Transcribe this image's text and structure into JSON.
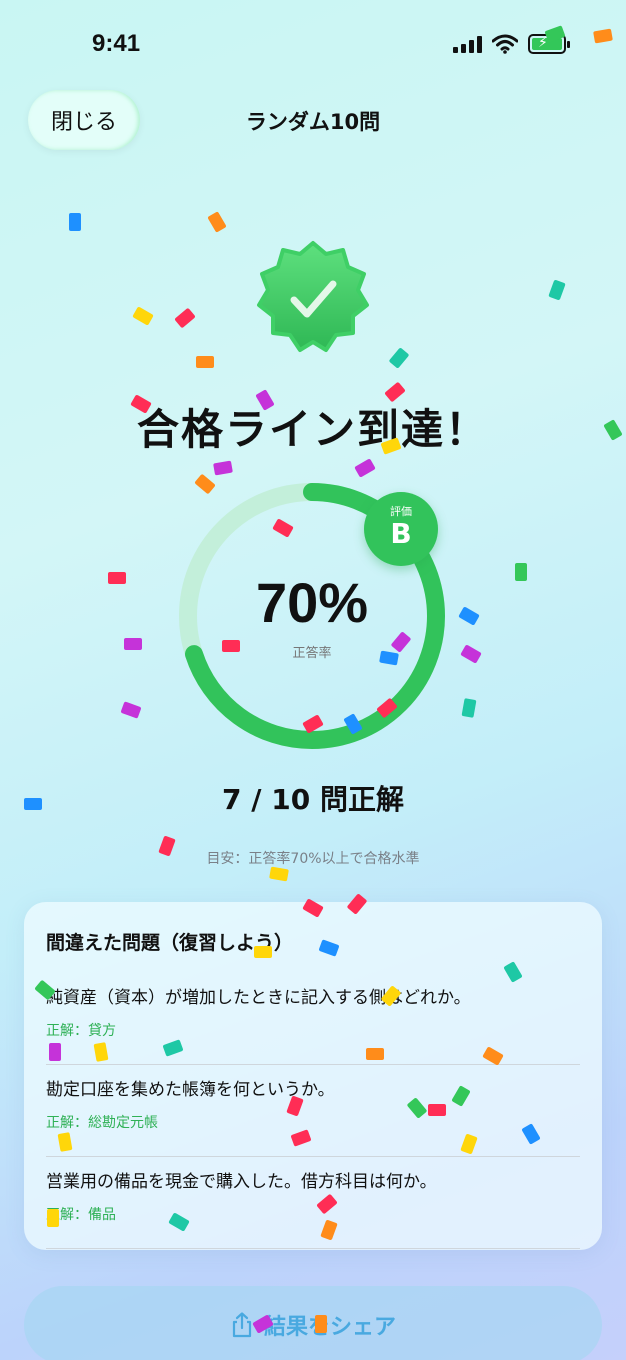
{
  "status_bar": {
    "time": "9:41"
  },
  "nav": {
    "close_label": "閉じる",
    "title": "ランダム10問"
  },
  "result": {
    "headline": "合格ライン到達！",
    "percent_text": "70%",
    "percent_value": 0.7,
    "percent_label": "正答率",
    "grade_label": "評価",
    "grade_value": "B",
    "score_text": "7 / 10 問正解",
    "hint": "目安：正答率70%以上で合格水準"
  },
  "mistakes": {
    "title": "間違えた問題（復習しよう）",
    "items": [
      {
        "question": "純資産（資本）が増加したときに記入する側はどれか。",
        "answer": "正解：貸方"
      },
      {
        "question": "勘定口座を集めた帳簿を何というか。",
        "answer": "正解：総勘定元帳"
      },
      {
        "question": "営業用の備品を現金で購入した。借方科目は何か。",
        "answer": "正解：備品"
      }
    ]
  },
  "share": {
    "label": "結果をシェア",
    "icon": "share-icon"
  },
  "colors": {
    "accent_green": "#32c35b",
    "answer_green": "#2fb156",
    "share_blue": "#49a9e0",
    "confetti": [
      "#1e90ff",
      "#ff8c1a",
      "#ff2d55",
      "#ffd60a",
      "#c533d9",
      "#1ec8a5",
      "#34c759"
    ]
  },
  "icons": {
    "badge": "checkmark-seal-icon",
    "signal": "cellular-signal-icon",
    "wifi": "wifi-icon",
    "battery": "battery-charging-icon"
  }
}
